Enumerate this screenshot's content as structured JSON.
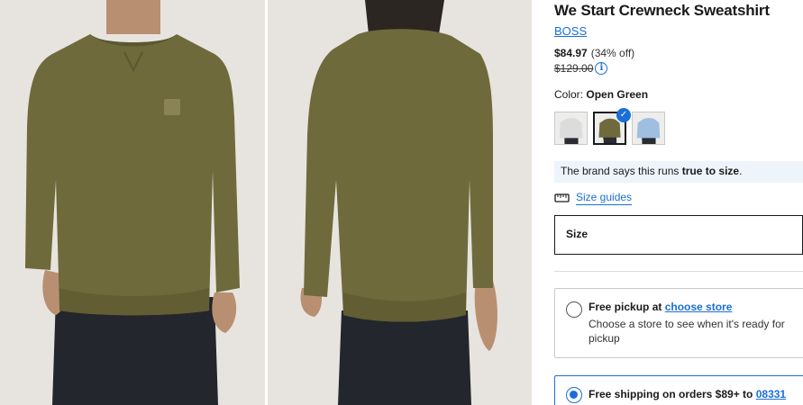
{
  "product": {
    "title": "We Start Crewneck Sweatshirt",
    "brand": "BOSS",
    "sale_price": "$84.97",
    "discount": "(34% off)",
    "original_price": "$129.00",
    "info_icon": "info-icon"
  },
  "color": {
    "label": "Color:",
    "value": "Open Green",
    "swatches": [
      {
        "name": "Light Grey",
        "color": "#dcdcdc",
        "selected": false
      },
      {
        "name": "Open Green",
        "color": "#6f6a3c",
        "selected": true
      },
      {
        "name": "Light Blue",
        "color": "#9fbfe0",
        "selected": false
      }
    ]
  },
  "fit": {
    "prefix": "The brand says this runs",
    "emphasis": "true to size",
    "suffix": "."
  },
  "size_guides": {
    "icon": "ruler-icon",
    "label": "Size guides"
  },
  "size": {
    "label": "Size"
  },
  "delivery": {
    "pickup": {
      "title": "Free pickup at",
      "link": "choose store",
      "subtitle": "Choose a store to see when it's ready for pickup"
    },
    "shipping": {
      "title": "Free shipping on orders $89+ to",
      "zip": "08331"
    }
  },
  "colors": {
    "accent": "#1a6fd6",
    "sweatshirt": "#6f6a3c",
    "background": "#e7e4df",
    "fit_bar": "#eef4fb"
  }
}
